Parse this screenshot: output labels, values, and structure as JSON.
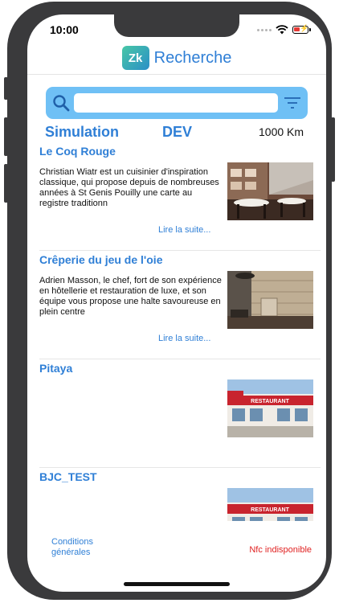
{
  "status": {
    "time": "10:00"
  },
  "header": {
    "logo_text": "Zk",
    "title": "Recherche"
  },
  "search": {
    "value": "",
    "placeholder": ""
  },
  "subbar": {
    "simulation": "Simulation",
    "dev": "DEV",
    "distance": "1000 Km"
  },
  "restaurants": [
    {
      "name": "Le Coq Rouge",
      "description": "Christian Wiatr est un cuisinier d'inspiration classique, qui propose depuis de nombreuses années à St Genis Pouilly une carte au registre traditionn",
      "more": "Lire la suite...",
      "image_icon": "restaurant-interior-photo"
    },
    {
      "name": "Crêperie du jeu de l'oie",
      "description": "Adrien Masson, le chef, fort de son expérience en hôtellerie et restauration de luxe, et son équipe vous propose une halte savoureuse en plein centre",
      "more": "Lire la suite...",
      "image_icon": "wooden-interior-photo"
    },
    {
      "name": "Pitaya",
      "description": "",
      "more": "",
      "image_icon": "restaurant-building-photo",
      "sign_text": "RESTAURANT"
    },
    {
      "name": "BJC_TEST",
      "description": "",
      "more": "",
      "image_icon": "restaurant-building-photo",
      "sign_text": "RESTAURANT"
    }
  ],
  "footer": {
    "conditions": "Conditions générales",
    "nfc_status": "Nfc indisponible"
  },
  "colors": {
    "accent": "#2f7fd6",
    "search_bar": "#6fc0f5",
    "error": "#e02222",
    "frame": "#3a3a3c"
  }
}
